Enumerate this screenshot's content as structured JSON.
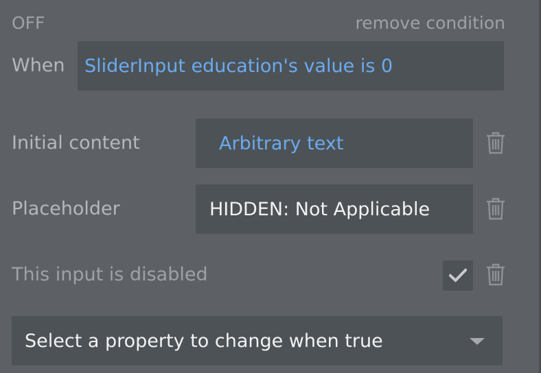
{
  "condition": {
    "state_label": "OFF",
    "remove_label": "remove condition",
    "when_label": "When",
    "when_expression": "SliderInput education's value is 0"
  },
  "properties": [
    {
      "label": "Initial content",
      "value": "Arbitrary text",
      "kind": "dynamic"
    },
    {
      "label": "Placeholder",
      "value": "HIDDEN: Not Applicable",
      "kind": "static"
    },
    {
      "label": "This input is disabled",
      "checked": true,
      "kind": "checkbox"
    }
  ],
  "property_select": {
    "value": "Select a property to change when true"
  },
  "icons": {
    "delete": "trash-icon",
    "check": "check-icon",
    "dropdown": "chevron-down-icon"
  },
  "colors": {
    "background": "#5d6165",
    "field": "#4d5256",
    "dynamic_text": "#6aabf0",
    "muted_text": "#9ea2a6",
    "label_text": "#b4b8bc"
  }
}
